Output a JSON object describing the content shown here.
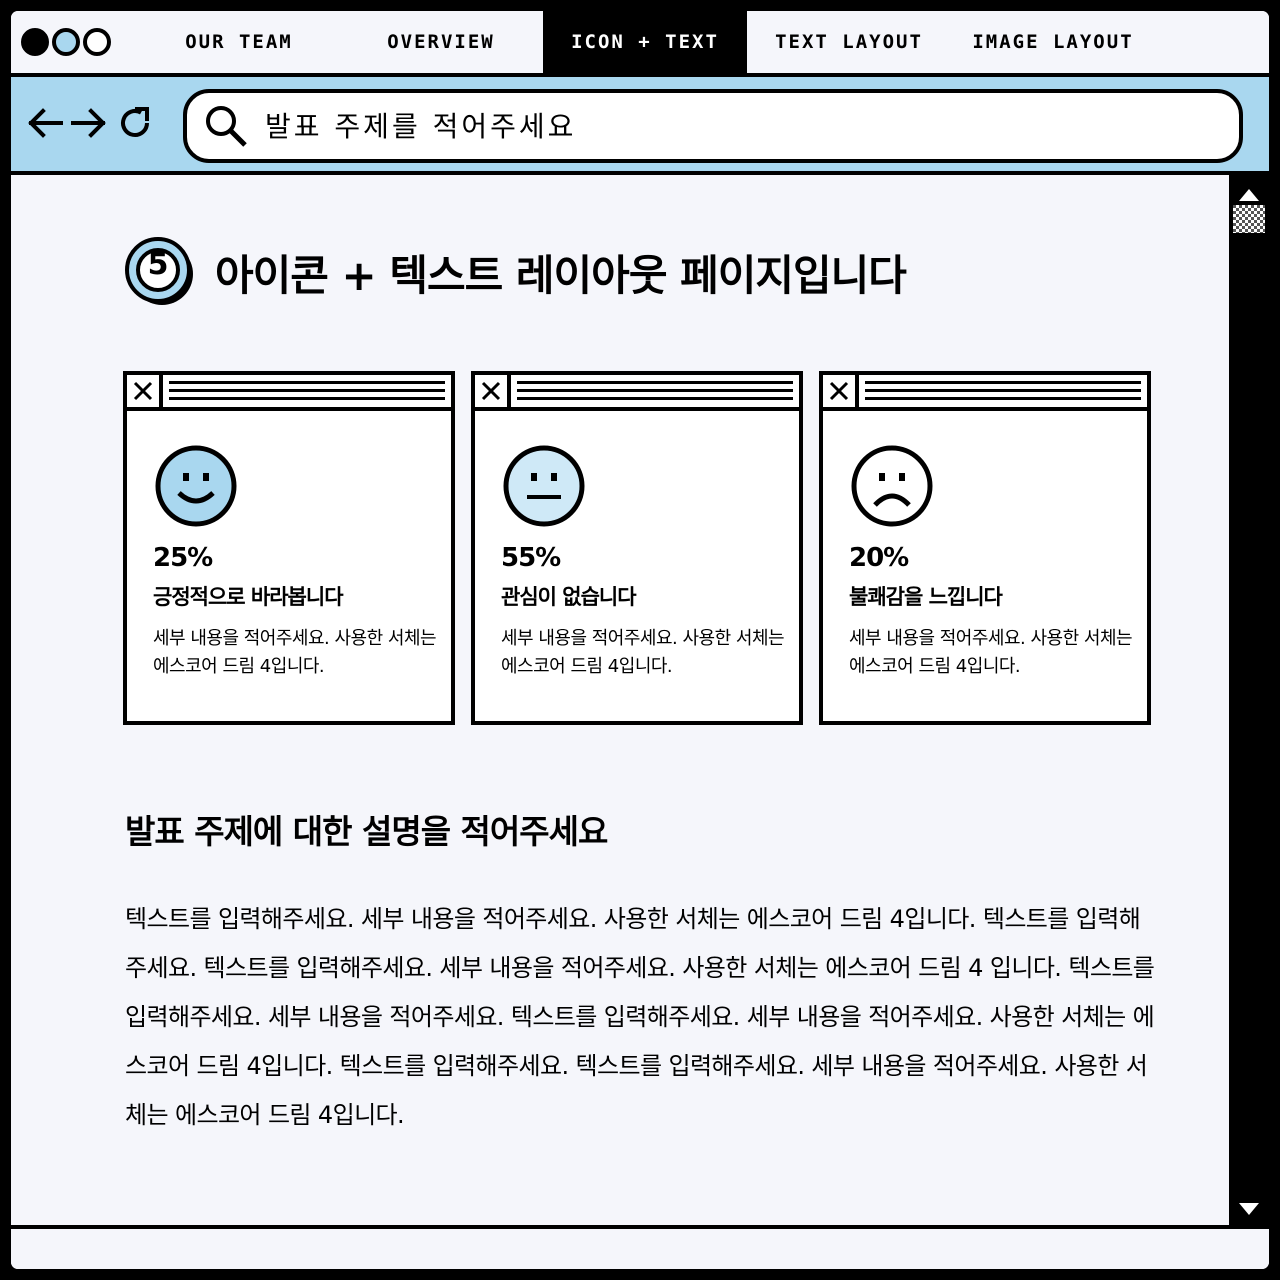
{
  "tabs": [
    {
      "label": "OUR TEAM",
      "active": false
    },
    {
      "label": "OVERVIEW",
      "active": false
    },
    {
      "label": "ICON + TEXT",
      "active": true
    },
    {
      "label": "TEXT LAYOUT",
      "active": false
    },
    {
      "label": "IMAGE LAYOUT",
      "active": false
    }
  ],
  "window_dots": [
    "black",
    "blue",
    "white"
  ],
  "colors": {
    "accent": "#a9d7ef",
    "background": "#f5f6fb",
    "dark": "#000000"
  },
  "nav": {
    "back_icon": "arrow-left-icon",
    "forward_icon": "arrow-right-icon",
    "refresh_icon": "refresh-icon"
  },
  "search": {
    "placeholder": "발표 주제를 적어주세요",
    "icon": "search-icon"
  },
  "page": {
    "number": "5",
    "title": "아이콘 + 텍스트 레이아웃 페이지입니다"
  },
  "cards": [
    {
      "icon": "smile-face-icon",
      "percent": "25%",
      "title": "긍정적으로 바라봅니다",
      "desc": "세부 내용을 적어주세요. 사용한 서체는 에스코어 드림 4입니다."
    },
    {
      "icon": "neutral-face-icon",
      "percent": "55%",
      "title": "관심이 없습니다",
      "desc": "세부 내용을 적어주세요. 사용한 서체는 에스코어 드림 4입니다."
    },
    {
      "icon": "frown-face-icon",
      "percent": "20%",
      "title": "불쾌감을 느낍니다",
      "desc": "세부 내용을 적어주세요. 사용한 서체는 에스코어 드림 4입니다."
    }
  ],
  "description": {
    "heading": "발표 주제에 대한 설명을 적어주세요",
    "body": "텍스트를 입력해주세요. 세부 내용을 적어주세요. 사용한 서체는 에스코어 드림 4입니다. 텍스트를 입력해주세요. 텍스트를 입력해주세요. 세부 내용을 적어주세요. 사용한 서체는 에스코어 드림 4 입니다. 텍스트를 입력해주세요. 세부 내용을 적어주세요. 텍스트를 입력해주세요. 세부 내용을 적어주세요. 사용한 서체는 에스코어 드림 4입니다. 텍스트를 입력해주세요. 텍스트를 입력해주세요. 세부 내용을 적어주세요. 사용한 서체는 에스코어 드림 4입니다."
  }
}
